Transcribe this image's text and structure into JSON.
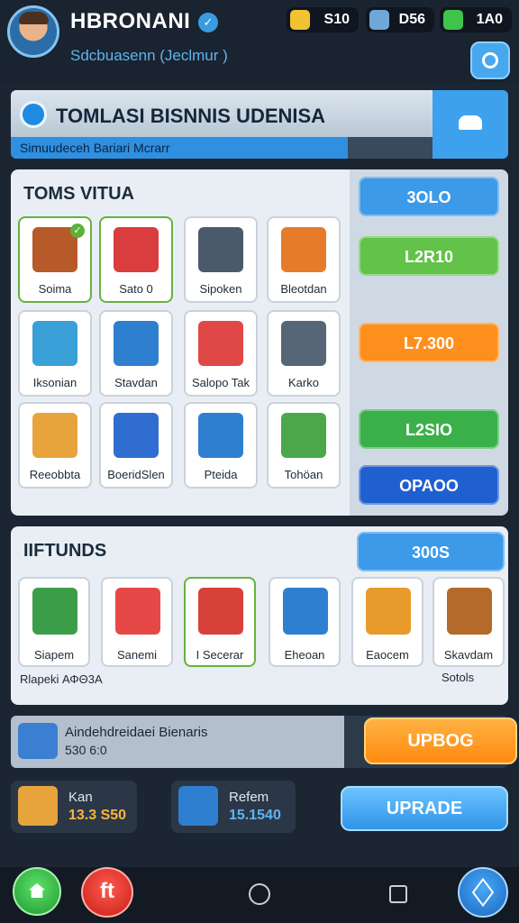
{
  "header": {
    "username": "HBRONANI",
    "subtitle": "Sdcbuasenn (Jeclmur )",
    "resources": [
      {
        "icon": "gold-cube-icon",
        "value": "S10",
        "color": "#f2c230"
      },
      {
        "icon": "character-portrait-icon",
        "value": "D56",
        "color": "#6fa7d8"
      },
      {
        "icon": "green-gem-icon",
        "value": "1A0",
        "color": "#3ec44a"
      }
    ]
  },
  "banner": {
    "title": "TOMLASI BISNNIS UDENISA",
    "subtitle": "Simuudeceh Bariari Mcrarr"
  },
  "panel1": {
    "title": "TOMS VITUA",
    "tiles": [
      {
        "label": "Soima",
        "icon": "warehouse-icon",
        "color": "#b75a2a"
      },
      {
        "label": "Sato 0",
        "icon": "shop-icon",
        "color": "#d93d3d"
      },
      {
        "label": "Sipoken",
        "icon": "phone-icon",
        "color": "#4b5a6a"
      },
      {
        "label": "Bleotdan",
        "icon": "factory-icon",
        "color": "#e67c2a"
      },
      {
        "label": "Iksonian",
        "icon": "house-icon",
        "color": "#3aa0d8"
      },
      {
        "label": "Stavdan",
        "icon": "target-icon",
        "color": "#2f7fd1"
      },
      {
        "label": "Salopo Tak",
        "icon": "market-stall-icon",
        "color": "#e04848"
      },
      {
        "label": "Karko",
        "icon": "monitor-icon",
        "color": "#566676"
      },
      {
        "label": "Reeobbta",
        "icon": "crate-icon",
        "color": "#e8a43c"
      },
      {
        "label": "BoeridSlen",
        "icon": "tape-icon",
        "color": "#2f6ed0"
      },
      {
        "label": "Pteida",
        "icon": "screen-icon",
        "color": "#2f7fd1"
      },
      {
        "label": "Tohöan",
        "icon": "robot-arm-icon",
        "color": "#4aa84a"
      }
    ],
    "buttons": [
      {
        "label": "3OLO",
        "color": "#3c9ae8"
      },
      {
        "label": "L2R10",
        "color": "#62c24a"
      },
      {
        "label": "L7.300",
        "color": "#ff8f1c"
      },
      {
        "label": "L2SIO",
        "color": "#3bb04a"
      },
      {
        "label": "OPAOO",
        "color": "#1f5fd0"
      }
    ]
  },
  "panel2": {
    "title": "IIFTUNDS",
    "button_label": "300S",
    "tiles": [
      {
        "label": "Siapem",
        "icon": "display-board-icon",
        "color": "#3d9e4a"
      },
      {
        "label": "Sanemi",
        "icon": "shop-icon",
        "color": "#e64848"
      },
      {
        "label": "I Secerar",
        "icon": "gift-box-icon",
        "color": "#d8403a"
      },
      {
        "label": "Eheoan",
        "icon": "calculator-icon",
        "color": "#2f7fd1"
      },
      {
        "label": "Eaocem",
        "icon": "machine-icon",
        "color": "#e89a2a"
      },
      {
        "label": "Skavdam",
        "icon": "wooden-crate-icon",
        "color": "#b36a2a"
      }
    ],
    "footer_left": "Rlapeki ΑΦΘ3Α",
    "footer_right": "Sotols"
  },
  "automation": {
    "title": "Aindehdreidaei Bienaris",
    "value": "530 6:0",
    "button_label": "UPBOG"
  },
  "stats": [
    {
      "name": "Kan",
      "value": "13.3 S50",
      "icon": "treasure-chest-icon",
      "color": "#e8a43c",
      "value_color": "#ffb43c"
    },
    {
      "name": "Refem",
      "value": "15.1540",
      "icon": "blue-crate-icon",
      "color": "#2f7fd1",
      "value_color": "#5fb4f0"
    }
  ],
  "upgrade_label": "UPRADE",
  "nav": {
    "alert_glyph": "ft"
  }
}
